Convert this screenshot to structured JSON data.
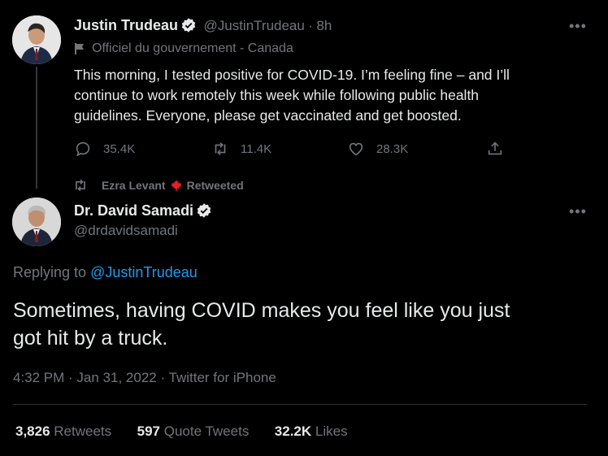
{
  "tweet1": {
    "name": "Justin Trudeau",
    "handle": "@JustinTrudeau",
    "separator": "·",
    "time": "8h",
    "label": "Officiel du gouvernement - Canada",
    "text_lines": [
      "This morning, I tested positive for COVID-19. I’m feeling fine – and I’ll",
      "continue to work remotely this week while following public health",
      "guidelines. Everyone, please get vaccinated and get boosted."
    ],
    "replies": "35.4K",
    "retweets": "11.4K",
    "likes": "28.3K",
    "more_label": "•••"
  },
  "retweet_banner": {
    "user": "Ezra Levant",
    "suffix": "Retweeted"
  },
  "tweet2": {
    "name": "Dr. David Samadi",
    "handle": "@drdavidsamadi",
    "more_label": "•••",
    "replying_prefix": "Replying to",
    "replying_to": "@JustinTrudeau",
    "text_lines": [
      "Sometimes, having COVID makes you feel like you just",
      "got hit by a truck."
    ],
    "meta": "4:32 PM · Jan 31, 2022 · Twitter for iPhone",
    "stats": {
      "retweets_num": "3,826",
      "retweets_label": "Retweets",
      "quotes_num": "597",
      "quotes_label": "Quote Tweets",
      "likes_num": "32.2K",
      "likes_label": "Likes"
    }
  },
  "colors": {
    "background": "#000000",
    "text": "#e7e9ea",
    "muted": "#71767b",
    "link": "#1d9bf0",
    "maple": "#e0202a"
  },
  "icons": [
    "verified-badge-icon",
    "government-flag-icon",
    "reply-icon",
    "retweet-icon",
    "like-icon",
    "share-icon",
    "maple-leaf-icon",
    "more-icon"
  ]
}
